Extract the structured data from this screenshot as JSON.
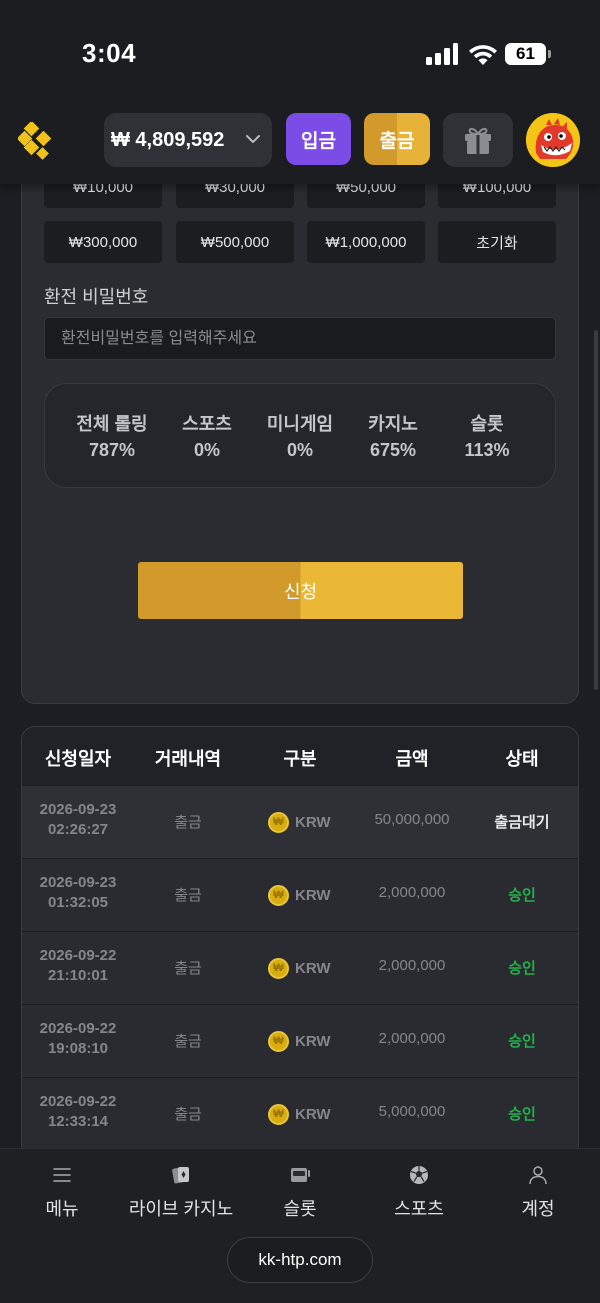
{
  "status_bar": {
    "time": "3:04",
    "battery": "61"
  },
  "header": {
    "balance": "₩ 4,809,592",
    "deposit_label": "입금",
    "withdraw_label": "출금"
  },
  "form": {
    "amount_buttons": [
      "₩10,000",
      "₩30,000",
      "₩50,000",
      "₩100,000",
      "₩300,000",
      "₩500,000",
      "₩1,000,000",
      "초기화"
    ],
    "password_label": "환전 비밀번호",
    "password_placeholder": "환전비밀번호를 입력해주세요",
    "rolling": [
      {
        "label": "전체 롤링",
        "value": "787%"
      },
      {
        "label": "스포츠",
        "value": "0%"
      },
      {
        "label": "미니게임",
        "value": "0%"
      },
      {
        "label": "카지노",
        "value": "675%"
      },
      {
        "label": "슬롯",
        "value": "113%"
      }
    ],
    "submit_label": "신청"
  },
  "history": {
    "columns": [
      "신청일자",
      "거래내역",
      "구분",
      "금액",
      "상태"
    ],
    "rows": [
      {
        "date": "2026-09-23",
        "time": "02:26:27",
        "type": "출금",
        "currency": "KRW",
        "amount": "50,000,000",
        "status": "출금대기",
        "status_color": "#e8e8ea"
      },
      {
        "date": "2026-09-23",
        "time": "01:32:05",
        "type": "출금",
        "currency": "KRW",
        "amount": "2,000,000",
        "status": "승인",
        "status_color": "#22b14c"
      },
      {
        "date": "2026-09-22",
        "time": "21:10:01",
        "type": "출금",
        "currency": "KRW",
        "amount": "2,000,000",
        "status": "승인",
        "status_color": "#22b14c"
      },
      {
        "date": "2026-09-22",
        "time": "19:08:10",
        "type": "출금",
        "currency": "KRW",
        "amount": "2,000,000",
        "status": "승인",
        "status_color": "#22b14c"
      },
      {
        "date": "2026-09-22",
        "time": "12:33:14",
        "type": "출금",
        "currency": "KRW",
        "amount": "5,000,000",
        "status": "승인",
        "status_color": "#22b14c"
      }
    ]
  },
  "bottom_nav": [
    {
      "label": "메뉴",
      "icon": "menu-icon"
    },
    {
      "label": "라이브 카지노",
      "icon": "cards-icon"
    },
    {
      "label": "슬롯",
      "icon": "slot-machine-icon"
    },
    {
      "label": "스포츠",
      "icon": "soccer-ball-icon"
    },
    {
      "label": "계정",
      "icon": "user-icon"
    }
  ],
  "browser": {
    "url": "kk-htp.com"
  },
  "colors": {
    "accent_purple": "#7b4ce6",
    "accent_gold": "#e6b338",
    "approved_green": "#22b14c"
  }
}
